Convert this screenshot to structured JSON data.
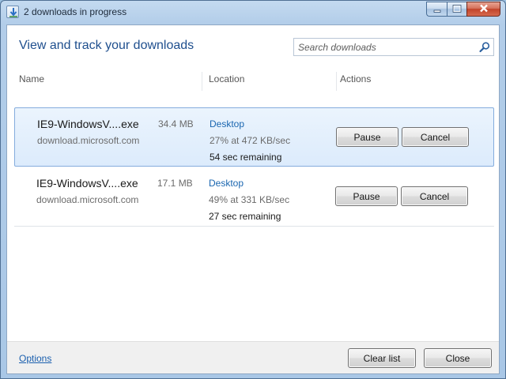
{
  "window": {
    "title": "2 downloads in progress"
  },
  "header": {
    "title": "View and track your downloads",
    "search_placeholder": "Search downloads"
  },
  "columns": {
    "name": "Name",
    "location": "Location",
    "actions": "Actions"
  },
  "downloads": [
    {
      "filename": "IE9-WindowsV....exe",
      "size": "34.4 MB",
      "source": "download.microsoft.com",
      "location": "Desktop",
      "progress": "27% at 472 KB/sec",
      "remaining": "54 sec remaining",
      "pause_label": "Pause",
      "cancel_label": "Cancel",
      "selected": true
    },
    {
      "filename": "IE9-WindowsV....exe",
      "size": "17.1 MB",
      "source": "download.microsoft.com",
      "location": "Desktop",
      "progress": "49% at 331 KB/sec",
      "remaining": "27 sec remaining",
      "pause_label": "Pause",
      "cancel_label": "Cancel",
      "selected": false
    }
  ],
  "footer": {
    "options_label": "Options",
    "clear_list_label": "Clear list",
    "close_label": "Close"
  },
  "icons": {
    "window": "download-manager-icon",
    "search": "search-icon",
    "minimize": "minimize-icon",
    "maximize": "maximize-icon",
    "close": "close-icon"
  },
  "colors": {
    "accent_title": "#1f4f8e",
    "link": "#1a66b0",
    "selected_row": "#dcebfc"
  }
}
